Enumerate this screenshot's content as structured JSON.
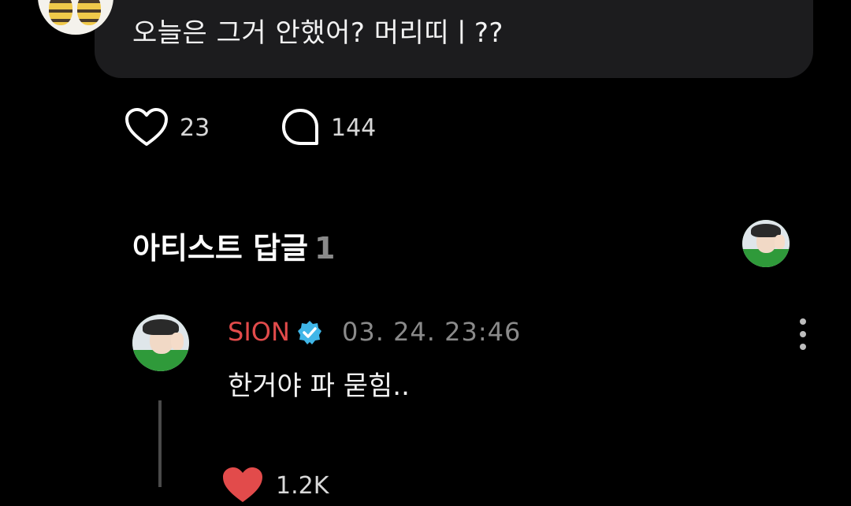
{
  "post": {
    "comment_text": "오늘은 그거 안했어? 머리띠ㅣ??",
    "likes": "23",
    "comments": "144"
  },
  "artist_replies": {
    "title": "아티스트 답글",
    "count": "1"
  },
  "reply": {
    "author": "SION",
    "timestamp": "03. 24. 23:46",
    "text": "한거야 파 묻힘..",
    "likes": "1.2K"
  },
  "colors": {
    "background": "#000000",
    "bubble": "#1c1c1e",
    "author_name": "#e24b4b",
    "verified_badge": "#3fb6e8",
    "like_filled": "#e24b4b",
    "muted_text": "#8a8a8a"
  },
  "icons": {
    "like": "heart-outline-icon",
    "comment": "speech-bubble-icon",
    "verified": "verified-badge-icon",
    "more": "more-vertical-icon",
    "reply_like": "heart-filled-icon"
  }
}
